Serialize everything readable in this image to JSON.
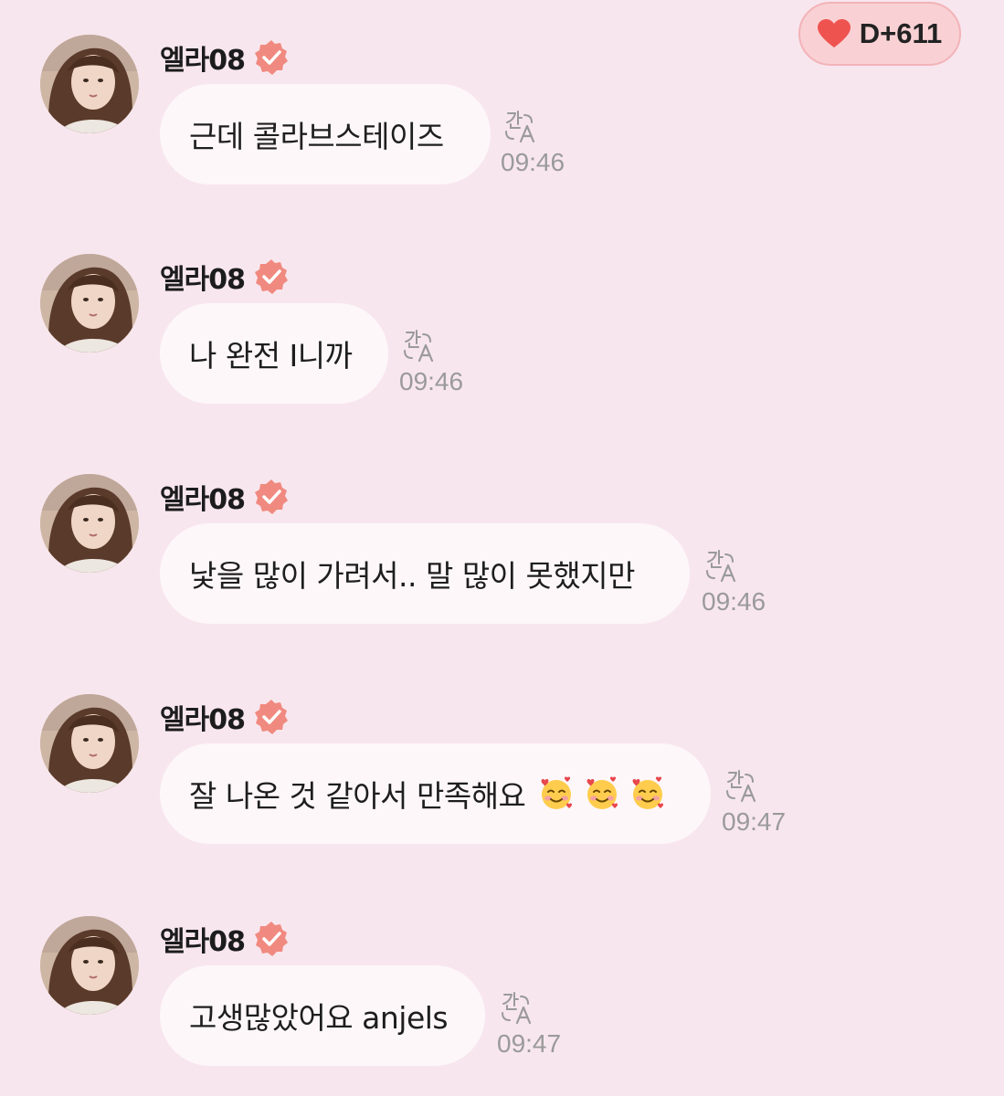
{
  "header": {
    "dday_label": "D+611",
    "heart_icon": "heart-icon",
    "heart_color": "#ef5350"
  },
  "colors": {
    "background": "#f8e6ee",
    "bubble": "#fdf7f9",
    "verified": "#f08a80",
    "time": "#9a9a9a"
  },
  "messages": [
    {
      "sender": "엘라08",
      "text": "근데 콜라브스테이즈",
      "time": "09:46",
      "emojis": 0
    },
    {
      "sender": "엘라08",
      "text": "나 완전 I니까",
      "time": "09:46",
      "emojis": 0
    },
    {
      "sender": "엘라08",
      "text": "낯을 많이 가려서.. 말 많이 못했지만",
      "time": "09:46",
      "emojis": 0
    },
    {
      "sender": "엘라08",
      "text": "잘 나온 것 같아서 만족해요",
      "time": "09:47",
      "emojis": 3
    },
    {
      "sender": "엘라08",
      "text": "고생많았어요 anjels",
      "time": "09:47",
      "emojis": 0
    }
  ]
}
